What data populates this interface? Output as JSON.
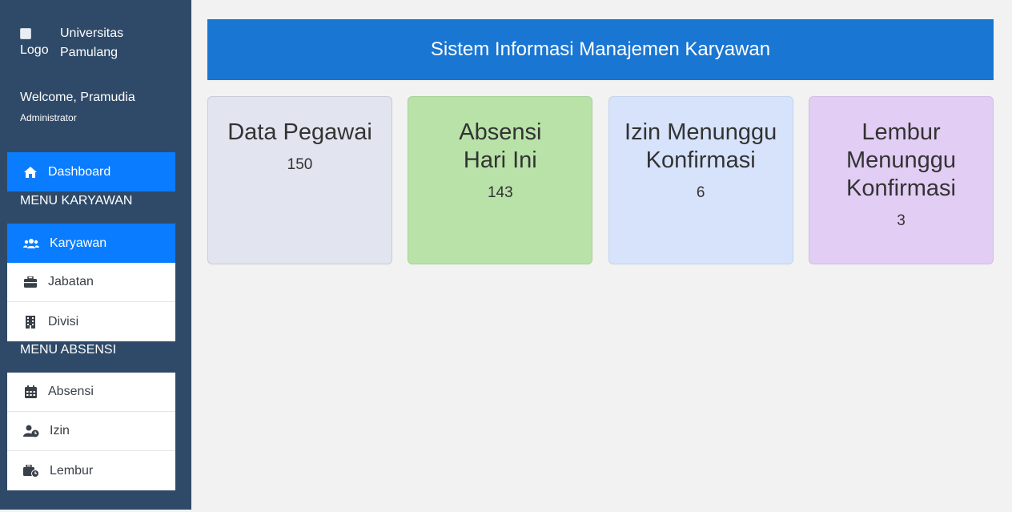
{
  "sidebar": {
    "logo_alt": "Logo",
    "brand": "Universitas Pamulang",
    "welcome": "Welcome, Pramudia",
    "role": "Administrator",
    "dashboard": "Dashboard",
    "section_karyawan": "MENU KARYAWAN",
    "karyawan_items": [
      "Karyawan",
      "Jabatan",
      "Divisi"
    ],
    "section_absensi": "MENU ABSENSI",
    "absensi_items": [
      "Absensi",
      "Izin",
      "Lembur"
    ],
    "active_color": "#0a7cff"
  },
  "header": {
    "title": "Sistem Informasi Manajemen Karyawan"
  },
  "cards": [
    {
      "title": "Data Pegawai",
      "value": "150",
      "color": "#e2e4ef"
    },
    {
      "title": "Absensi Hari Ini",
      "value": "143",
      "color": "#b9e2a9"
    },
    {
      "title": "Izin Menunggu Konfirmasi",
      "value": "6",
      "color": "#d6e3fb"
    },
    {
      "title": "Lembur Menunggu Konfirmasi",
      "value": "3",
      "color": "#e2cdf4"
    }
  ]
}
